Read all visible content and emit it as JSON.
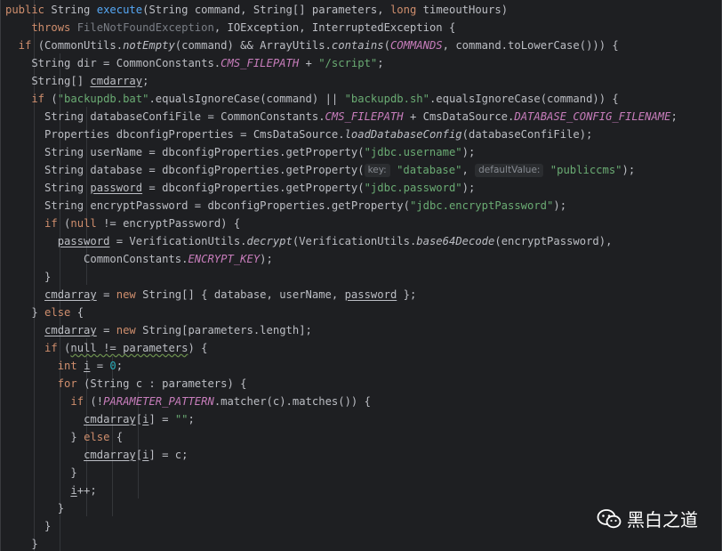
{
  "code_lines": [
    [
      [
        "public ",
        "kw"
      ],
      [
        "String ",
        ""
      ],
      [
        "execute",
        "fn"
      ],
      [
        "(String command, String[] parameters, ",
        ""
      ],
      [
        "long ",
        "kw"
      ],
      [
        "timeoutHours)",
        ""
      ]
    ],
    [
      [
        "    throws ",
        "kw"
      ],
      [
        "FileNotFoundException",
        "unused"
      ],
      [
        ", IOException, InterruptedException {",
        ""
      ]
    ],
    [
      [
        "  if ",
        "kw"
      ],
      [
        "(CommonUtils.",
        ""
      ],
      [
        "notEmpty",
        "ital"
      ],
      [
        "(command) && ArrayUtils.",
        ""
      ],
      [
        "contains",
        "ital"
      ],
      [
        "(",
        ""
      ],
      [
        "COMMANDS",
        "cst"
      ],
      [
        ", command.toLowerCase())) {",
        ""
      ]
    ],
    [
      [
        "    String dir = CommonConstants.",
        ""
      ],
      [
        "CMS_FILEPATH",
        "cst"
      ],
      [
        " + ",
        ""
      ],
      [
        "\"/script\"",
        "st"
      ],
      [
        ";",
        ""
      ]
    ],
    [
      [
        "    String[] ",
        ""
      ],
      [
        "cmdarray",
        "u"
      ],
      [
        ";",
        ""
      ]
    ],
    [
      [
        "    if ",
        "kw"
      ],
      [
        "(",
        ""
      ],
      [
        "\"backupdb.bat\"",
        "st"
      ],
      [
        ".equalsIgnoreCase(command) || ",
        ""
      ],
      [
        "\"backupdb.sh\"",
        "st"
      ],
      [
        ".equalsIgnoreCase(command)) {",
        ""
      ]
    ],
    [
      [
        "      String databaseConfiFile = CommonConstants.",
        ""
      ],
      [
        "CMS_FILEPATH",
        "cst"
      ],
      [
        " + CmsDataSource.",
        ""
      ],
      [
        "DATABASE_CONFIG_FILENAME",
        "cst"
      ],
      [
        ";",
        ""
      ]
    ],
    [
      [
        "      Properties dbconfigProperties = CmsDataSource.",
        ""
      ],
      [
        "loadDatabaseConfig",
        "ital"
      ],
      [
        "(databaseConfiFile);",
        ""
      ]
    ],
    [
      [
        "      String userName = dbconfigProperties.getProperty(",
        ""
      ],
      [
        "\"jdbc.username\"",
        "st"
      ],
      [
        ");",
        ""
      ]
    ],
    [
      [
        "      String database = dbconfigProperties.getProperty(",
        ""
      ],
      [
        "key:",
        "hint"
      ],
      [
        " ",
        ""
      ],
      [
        "\"database\"",
        "st"
      ],
      [
        ", ",
        ""
      ],
      [
        "defaultValue:",
        "hint"
      ],
      [
        " ",
        ""
      ],
      [
        "\"publiccms\"",
        "st"
      ],
      [
        ");",
        ""
      ]
    ],
    [
      [
        "      String ",
        ""
      ],
      [
        "password",
        "u"
      ],
      [
        " = dbconfigProperties.getProperty(",
        ""
      ],
      [
        "\"jdbc.password\"",
        "st"
      ],
      [
        ");",
        ""
      ]
    ],
    [
      [
        "      String encryptPassword = dbconfigProperties.getProperty(",
        ""
      ],
      [
        "\"jdbc.encryptPassword\"",
        "st"
      ],
      [
        ");",
        ""
      ]
    ],
    [
      [
        "      if ",
        "kw"
      ],
      [
        "(",
        ""
      ],
      [
        "null ",
        "kw"
      ],
      [
        "!= encryptPassword) {",
        ""
      ]
    ],
    [
      [
        "        ",
        ""
      ],
      [
        "password",
        "u"
      ],
      [
        " = VerificationUtils.",
        ""
      ],
      [
        "decrypt",
        "ital"
      ],
      [
        "(VerificationUtils.",
        ""
      ],
      [
        "base64Decode",
        "ital"
      ],
      [
        "(encryptPassword),",
        ""
      ]
    ],
    [
      [
        "            CommonConstants.",
        ""
      ],
      [
        "ENCRYPT_KEY",
        "cst"
      ],
      [
        ");",
        ""
      ]
    ],
    [
      [
        "      }",
        ""
      ]
    ],
    [
      [
        "      ",
        ""
      ],
      [
        "cmdarray",
        "u"
      ],
      [
        " = ",
        ""
      ],
      [
        "new ",
        "kw"
      ],
      [
        "String[] { database, userName, ",
        ""
      ],
      [
        "password",
        "u"
      ],
      [
        " };",
        ""
      ]
    ],
    [
      [
        "    } ",
        ""
      ],
      [
        "else ",
        "kw"
      ],
      [
        "{",
        ""
      ]
    ],
    [
      [
        "      ",
        ""
      ],
      [
        "cmdarray",
        "u"
      ],
      [
        " = ",
        ""
      ],
      [
        "new ",
        "kw"
      ],
      [
        "String[parameters.length];",
        ""
      ]
    ],
    [
      [
        "      if ",
        "kw"
      ],
      [
        "(",
        ""
      ],
      [
        "null != parameters",
        "uw"
      ],
      [
        ") {",
        ""
      ]
    ],
    [
      [
        "        int ",
        "kw"
      ],
      [
        "i",
        "u"
      ],
      [
        " = ",
        ""
      ],
      [
        "0",
        "num"
      ],
      [
        ";",
        ""
      ]
    ],
    [
      [
        "        for ",
        "kw"
      ],
      [
        "(String c : parameters) {",
        ""
      ]
    ],
    [
      [
        "          if ",
        "kw"
      ],
      [
        "(!",
        ""
      ],
      [
        "PARAMETER_PATTERN",
        "cst"
      ],
      [
        ".matcher(c).matches()) {",
        ""
      ]
    ],
    [
      [
        "            ",
        ""
      ],
      [
        "cmdarray",
        "u"
      ],
      [
        "[",
        ""
      ],
      [
        "i",
        "u"
      ],
      [
        "] = ",
        ""
      ],
      [
        "\"\"",
        "st"
      ],
      [
        ";",
        ""
      ]
    ],
    [
      [
        "          } ",
        ""
      ],
      [
        "else ",
        "kw"
      ],
      [
        "{",
        ""
      ]
    ],
    [
      [
        "            ",
        ""
      ],
      [
        "cmdarray",
        "u"
      ],
      [
        "[",
        ""
      ],
      [
        "i",
        "u"
      ],
      [
        "] = c;",
        ""
      ]
    ],
    [
      [
        "          }",
        ""
      ]
    ],
    [
      [
        "          ",
        ""
      ],
      [
        "i",
        "u"
      ],
      [
        "++;",
        ""
      ]
    ],
    [
      [
        "        }",
        ""
      ]
    ],
    [
      [
        "      }",
        ""
      ]
    ],
    [
      [
        "    }",
        ""
      ]
    ],
    [
      [
        "  }",
        ""
      ]
    ]
  ],
  "watermark": {
    "icon": "wechat-icon",
    "text": "黑白之道"
  },
  "colors": {
    "background": "#1e1f22",
    "keyword": "#cf8e6d",
    "function": "#56a8f5",
    "string": "#6aab73",
    "number": "#2aacb8",
    "constant": "#c77dbb",
    "text": "#bcbec4"
  }
}
